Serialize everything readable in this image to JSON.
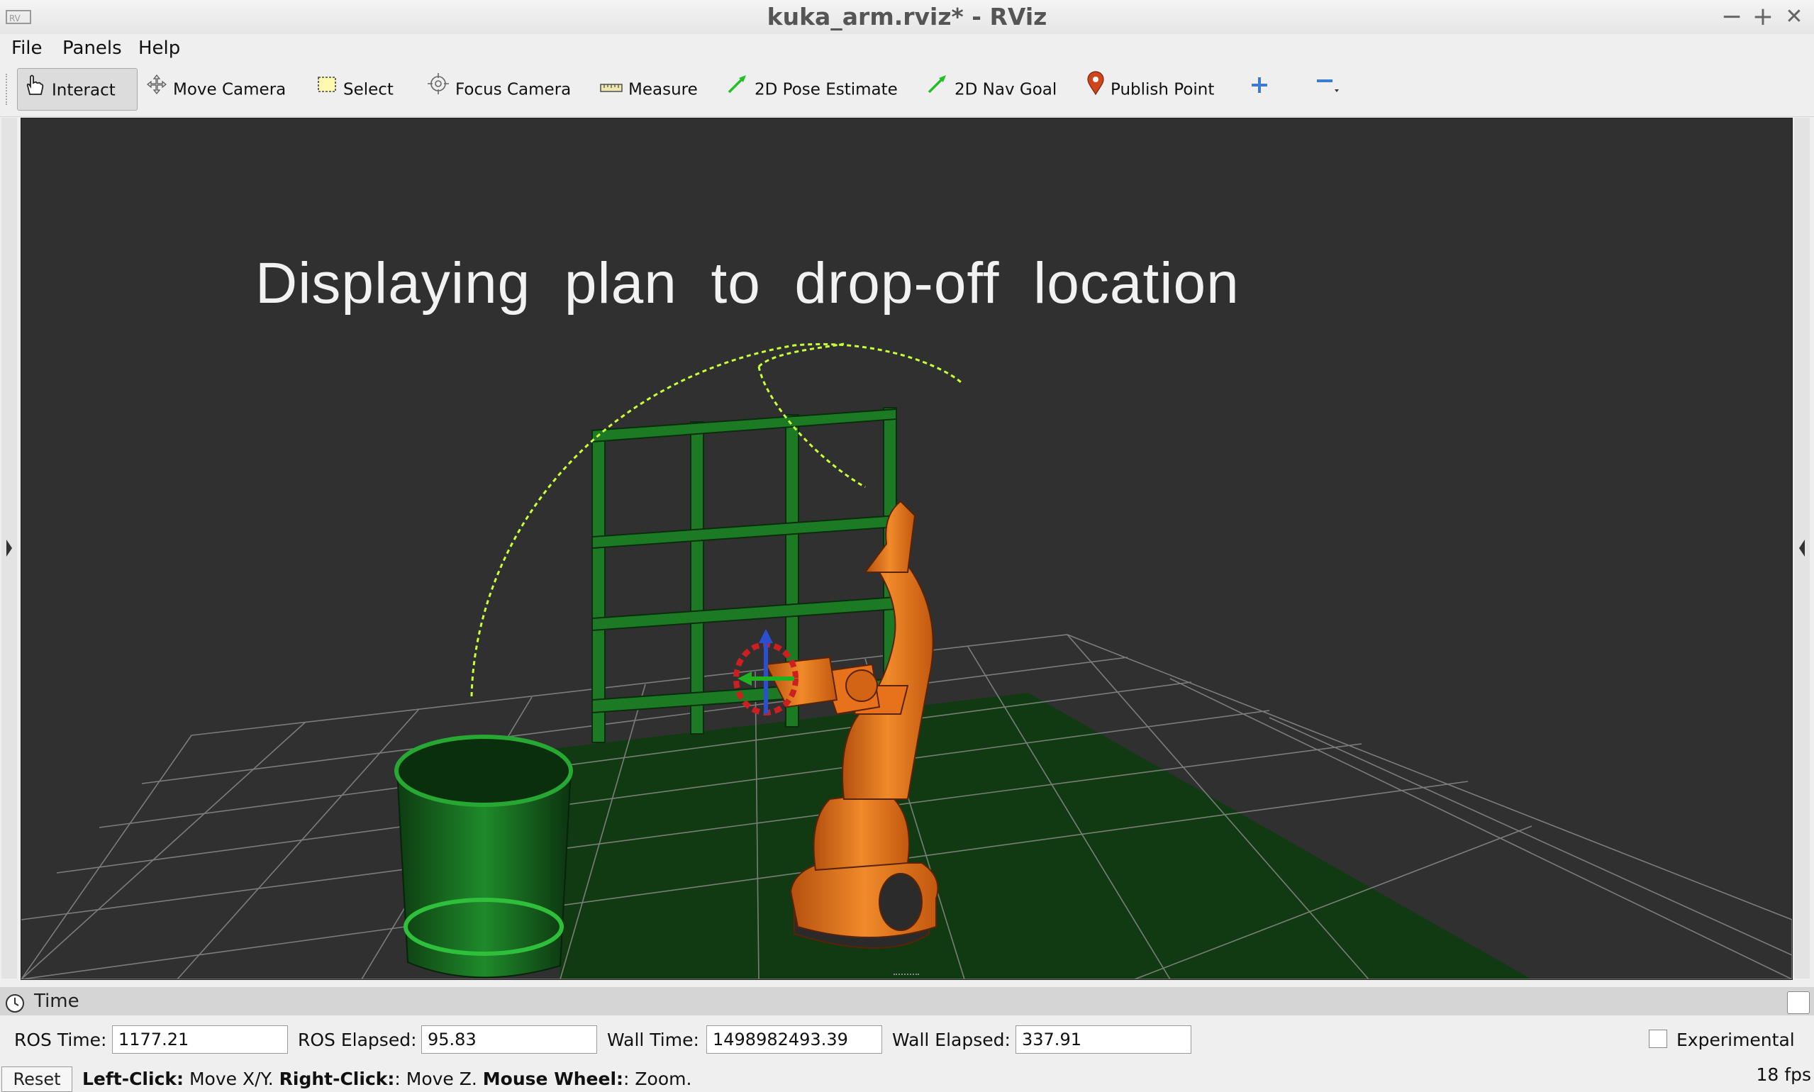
{
  "window": {
    "title": "kuka_arm.rviz* - RViz",
    "minimize_glyph": "−",
    "maximize_glyph": "+",
    "close_glyph": "✕"
  },
  "menu": [
    "File",
    "Panels",
    "Help"
  ],
  "toolbar": {
    "interact": "Interact",
    "move_camera": "Move Camera",
    "select": "Select",
    "focus_camera": "Focus Camera",
    "measure": "Measure",
    "pose_estimate": "2D Pose Estimate",
    "nav_goal": "2D Nav Goal",
    "publish_point": "Publish Point"
  },
  "viewport": {
    "overlay_text": "Displaying  plan  to  drop-off  location"
  },
  "time_panel": {
    "title": "Time",
    "ros_time_label": "ROS Time:",
    "ros_time": "1177.21",
    "ros_elapsed_label": "ROS Elapsed:",
    "ros_elapsed": "95.83",
    "wall_time_label": "Wall Time:",
    "wall_time": "1498982493.39",
    "wall_elapsed_label": "Wall Elapsed:",
    "wall_elapsed": "337.91",
    "experimental_label": "Experimental",
    "experimental_checked": false
  },
  "statusbar": {
    "reset": "Reset",
    "left_click": "Left-Click:",
    "left_click_action": " Move X/Y. ",
    "right_click": "Right-Click:",
    "right_click_action": ": Move Z. ",
    "wheel": "Mouse Wheel:",
    "wheel_action": ": Zoom.",
    "fps": "18 fps"
  },
  "icons": [
    "hand-icon",
    "move-camera-icon",
    "select-icon",
    "focus-camera-icon",
    "measure-icon",
    "pose-estimate-arrow-icon",
    "nav-goal-arrow-icon",
    "map-pin-icon",
    "plus-icon",
    "minus-icon",
    "clock-icon"
  ],
  "colors": {
    "viewport_bg": "#303030",
    "robot_orange": "#e8721c",
    "shelf_green": "#1f8a2a",
    "trajectory": "#c8ff3a"
  }
}
